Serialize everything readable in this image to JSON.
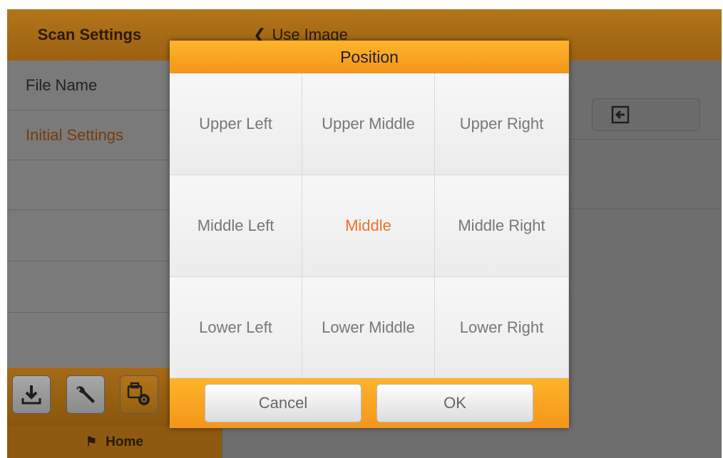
{
  "sidebar": {
    "title": "Scan Settings",
    "items": [
      {
        "label": "File Name"
      },
      {
        "label": "Initial Settings"
      },
      {
        "label": ""
      },
      {
        "label": ""
      },
      {
        "label": ""
      }
    ],
    "toolbar": {
      "icons": [
        "download-icon",
        "wrench-icon",
        "settings-gear-icon"
      ]
    },
    "home_label": "Home"
  },
  "content": {
    "back_label": "Use Image",
    "export_icon": "import-arrow-icon"
  },
  "dialog": {
    "title": "Position",
    "options": [
      "Upper Left",
      "Upper Middle",
      "Upper Right",
      "Middle Left",
      "Middle",
      "Middle Right",
      "Lower Left",
      "Lower Middle",
      "Lower Right"
    ],
    "selected": "Middle",
    "cancel_label": "Cancel",
    "ok_label": "OK"
  },
  "colors": {
    "accent": "#f3961b",
    "selected_text": "#e8762c"
  }
}
